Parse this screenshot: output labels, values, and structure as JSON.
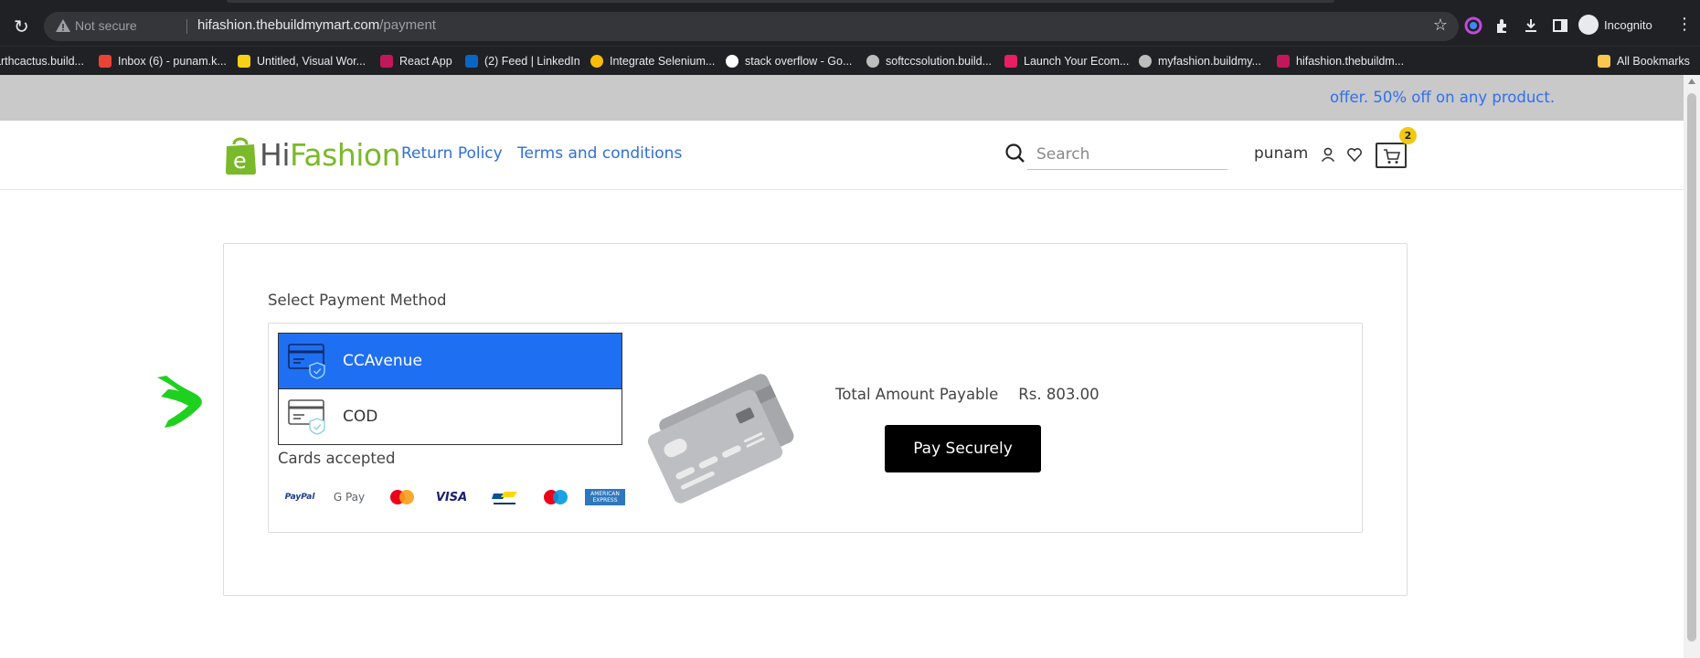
{
  "browser": {
    "security_label": "Not secure",
    "url_host": "hifashion.thebuildmymart.com",
    "url_path": "/payment",
    "profile_label": "Incognito",
    "bookmarks": [
      {
        "label": "arthcactus.build...",
        "color": "#f0b400"
      },
      {
        "label": "Inbox (6) - punam.k...",
        "color": "#ea4335"
      },
      {
        "label": "Untitled, Visual Wor...",
        "color": "#f7d117"
      },
      {
        "label": "React App",
        "color": "#c2185b"
      },
      {
        "label": "(2) Feed | LinkedIn",
        "color": "#0a66c2"
      },
      {
        "label": "Integrate Selenium...",
        "color": "#fbbc05"
      },
      {
        "label": "stack overflow - Go...",
        "color": "#ffffff"
      },
      {
        "label": "softccsolution.build...",
        "color": "#bdbdbd"
      },
      {
        "label": "Launch Your Ecom...",
        "color": "#e91e63"
      },
      {
        "label": "myfashion.buildmy...",
        "color": "#bdbdbd"
      },
      {
        "label": "hifashion.thebuildm...",
        "color": "#c2185b"
      }
    ],
    "all_bookmarks_label": "All Bookmarks"
  },
  "offer_text": "offer. 50% off on any product.",
  "header": {
    "logo_hi": "Hi",
    "logo_fashion": "Fashion",
    "nav": [
      "Return Policy",
      "Terms and conditions"
    ],
    "search_placeholder": "Search",
    "username": "punam",
    "cart_count": "2"
  },
  "payment": {
    "title": "Select Payment Method",
    "methods": [
      {
        "label": "CCAvenue",
        "selected": true
      },
      {
        "label": "COD",
        "selected": false
      }
    ],
    "cards_accepted_label": "Cards accepted",
    "brands": [
      "PayPal",
      "G Pay",
      "mastercard",
      "VISA",
      "Bancontact",
      "maestro",
      "AMERICAN EXPRESS"
    ],
    "total_label": "Total Amount Payable",
    "total_amount": "Rs. 803.00",
    "pay_button": "Pay Securely"
  },
  "colors": {
    "accent_blue": "#1f6ff2",
    "link_blue": "#2f6fd6",
    "brand_green": "#7ab929",
    "badge_yellow": "#f2c811"
  }
}
